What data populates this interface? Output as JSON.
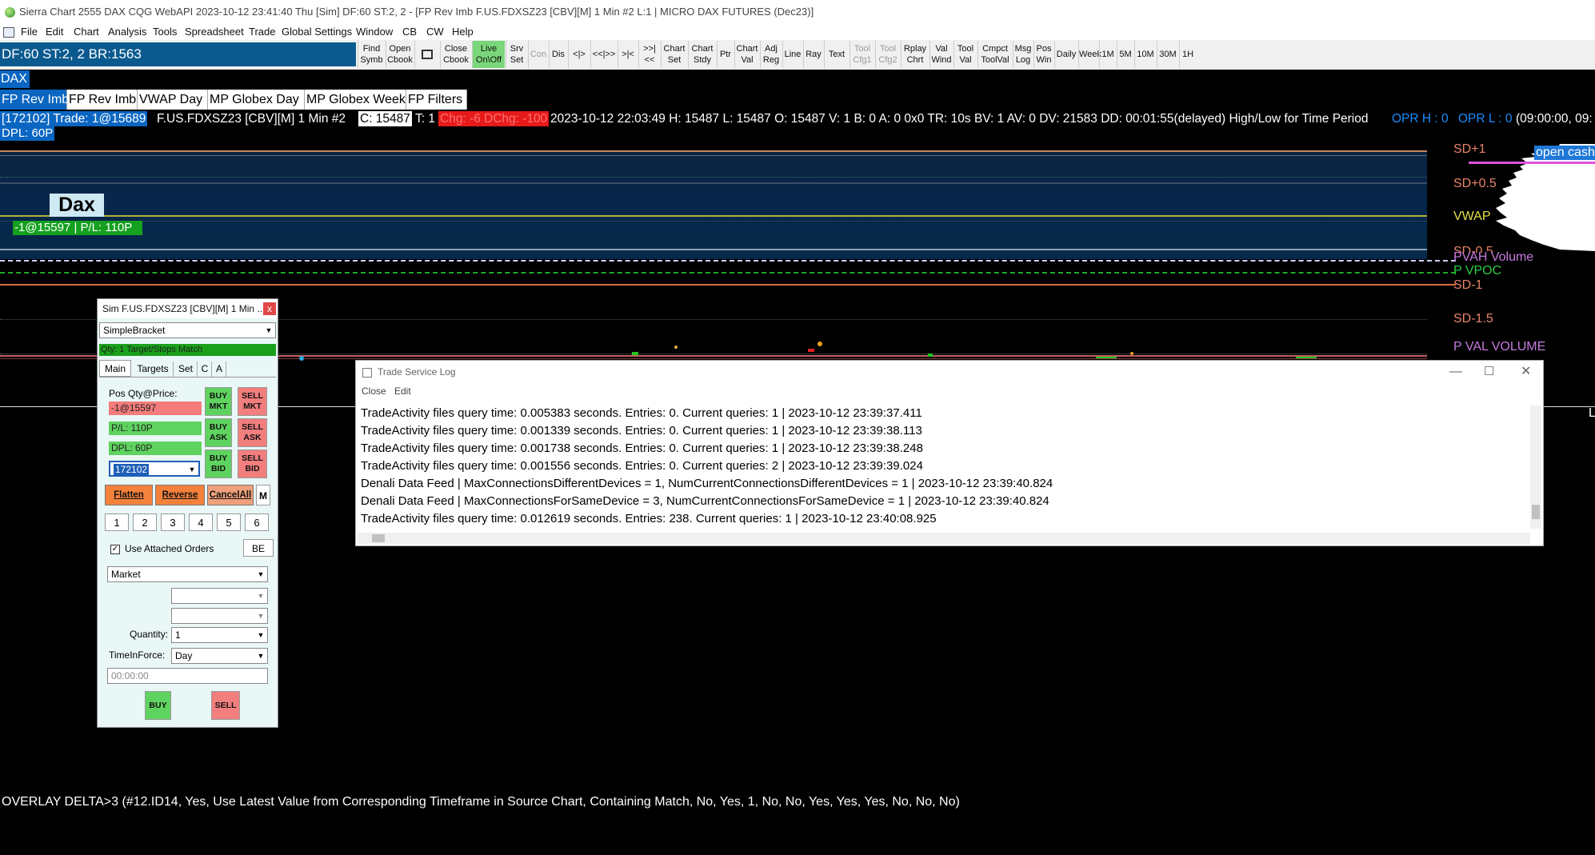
{
  "window": {
    "title": "Sierra Chart 2555 DAX CQG WebAPI 2023-10-12  23:41:40 Thu [Sim]  DF:60  ST:2, 2 - [FP Rev Imb F.US.FDXSZ23 [CBV][M]  1 Min  #2 L:1 | MICRO DAX FUTURES (Dec23)]"
  },
  "menu": [
    "File",
    "Edit",
    "Chart",
    "Analysis",
    "Tools",
    "Spreadsheet",
    "Trade",
    "Global Settings",
    "Window",
    "CB",
    "CW",
    "Help"
  ],
  "toolbar": {
    "status": "DF:60  ST:2, 2  BR:1563",
    "buttons": [
      {
        "l1": "Find",
        "l2": "Symb"
      },
      {
        "l1": "Open",
        "l2": "Cbook"
      },
      {
        "l1": "",
        "l2": ""
      },
      {
        "l1": "Close",
        "l2": "Cbook"
      },
      {
        "l1": "Live",
        "l2": "On\\Off"
      },
      {
        "l1": "Srv",
        "l2": "Set"
      },
      {
        "l1": "Con",
        "l2": ""
      },
      {
        "l1": "Dis",
        "l2": ""
      },
      {
        "l1": "<|>",
        "l2": ""
      },
      {
        "l1": "<<|>>",
        "l2": ""
      },
      {
        "l1": ">|<",
        "l2": ""
      },
      {
        "l1": ">>|<<",
        "l2": ""
      },
      {
        "l1": "Chart",
        "l2": "Set"
      },
      {
        "l1": "Chart",
        "l2": "Stdy"
      },
      {
        "l1": "Ptr",
        "l2": ""
      },
      {
        "l1": "Chart",
        "l2": "Val"
      },
      {
        "l1": "Adj",
        "l2": "Reg"
      },
      {
        "l1": "Line",
        "l2": ""
      },
      {
        "l1": "Ray",
        "l2": ""
      },
      {
        "l1": "Text",
        "l2": ""
      },
      {
        "l1": "Tool",
        "l2": "Cfg1"
      },
      {
        "l1": "Tool",
        "l2": "Cfg2"
      },
      {
        "l1": "Rplay",
        "l2": "Chrt"
      },
      {
        "l1": "Val",
        "l2": "Wind"
      },
      {
        "l1": "Tool",
        "l2": "Val"
      },
      {
        "l1": "Cmpct",
        "l2": "ToolVal"
      },
      {
        "l1": "Msg",
        "l2": "Log"
      },
      {
        "l1": "Pos",
        "l2": "Win"
      },
      {
        "l1": "Daily",
        "l2": ""
      },
      {
        "l1": "Week",
        "l2": ""
      },
      {
        "l1": "1M",
        "l2": ""
      },
      {
        "l1": "5M",
        "l2": ""
      },
      {
        "l1": "10M",
        "l2": ""
      },
      {
        "l1": "30M",
        "l2": ""
      },
      {
        "l1": "1H",
        "l2": ""
      }
    ]
  },
  "symbol_tab": "DAX",
  "chart_tabs": [
    "FP Rev Imb",
    "FP Rev Imb",
    "VWAP Day",
    "MP Globex Day",
    "MP Globex Week",
    "FP Filters"
  ],
  "info": {
    "account": "[172102]  Trade: 1@15689",
    "symbol": "F.US.FDXSZ23 [CBV][M]  1 Min  #2",
    "close": "C: 15487",
    "t": "T: 1",
    "chg": "Chg: -6",
    "dchg": "DChg: -100",
    "rest": "2023-10-12 22:03:49 H: 15487 L: 15487 O: 15487 V: 1 B: 0 A: 0 0x0 TR: 10s BV: 1 AV: 0 DV: 21583 DD: 00:01:55(delayed) High/Low for Time Period",
    "oprh": "OPR H : 0",
    "oprl": "OPR L : 0",
    "time": "(09:00:00, 09:",
    "dpl": "DPL: 60P"
  },
  "chart_labels": {
    "sd_p1": "SD+1",
    "open_cash": "open cash",
    "sd_p05": "SD+0.5",
    "vwap": "VWAP",
    "sd_m05": "SD-0.5",
    "pvah": "PVAH Volume",
    "pvpoc": "P VPOC",
    "sd_m1": "SD-1",
    "sd_m15": "SD-1.5",
    "pval": "P VAL VOLUME",
    "edge_l": "L"
  },
  "dax_label": "Dax",
  "position_label": "-1@15597 | P/L: 110P",
  "trade_window": {
    "title": "Sim F.US.FDXSZ23 [CBV][M]  1 Min  ...",
    "close": "x",
    "strategy": "SimpleBracket",
    "qty_target": "Qty: 1 Target/Stops Match",
    "tabs": [
      "Main",
      "Targets",
      "Set",
      "C",
      "A"
    ],
    "pos_label": "Pos Qty@Price:",
    "pos_value": "-1@15597",
    "pl": "P/L: 110P",
    "dpl": "DPL: 60P",
    "account": "172102",
    "buy_mkt": "BUY MKT",
    "sell_mkt": "SELL MKT",
    "buy_ask": "BUY ASK",
    "sell_ask": "SELL ASK",
    "buy_bid": "BUY BID",
    "sell_bid": "SELL BID",
    "flatten": "Flatten",
    "reverse": "Reverse",
    "cancel_all": "CancelAll",
    "m": "M",
    "numbers": [
      "1",
      "2",
      "3",
      "4",
      "5",
      "6"
    ],
    "attached": "Use Attached Orders",
    "be": "BE",
    "order_type": "Market",
    "quantity_label": "Quantity:",
    "quantity": "1",
    "tif_label": "TimeInForce:",
    "tif": "Day",
    "time": "00:00:00",
    "buy": "BUY",
    "sell": "SELL"
  },
  "log_window": {
    "title": "Trade Service Log",
    "menu": [
      "Close",
      "Edit"
    ],
    "lines": [
      "TradeActivity files query time: 0.005383 seconds. Entries: 0. Current queries: 1 | 2023-10-12  23:39:37.411",
      "TradeActivity files query time: 0.001339 seconds. Entries: 0. Current queries: 1 | 2023-10-12  23:39:38.113",
      "TradeActivity files query time: 0.001738 seconds. Entries: 0. Current queries: 1 | 2023-10-12  23:39:38.248",
      "TradeActivity files query time: 0.001556 seconds. Entries: 0. Current queries: 2 | 2023-10-12  23:39:39.024",
      "Denali Data Feed | MaxConnectionsDifferentDevices = 1, NumCurrentConnectionsDifferentDevices = 1 | 2023-10-12  23:39:40.824",
      "Denali Data Feed | MaxConnectionsForSameDevice = 3, NumCurrentConnectionsForSameDevice = 1 | 2023-10-12  23:39:40.824",
      "TradeActivity files query time: 0.012619 seconds. Entries: 238. Current queries: 1 | 2023-10-12  23:40:08.925"
    ]
  },
  "bottom_text": "OVERLAY DELTA>3   (#12.ID14, Yes, Use Latest Value from Corresponding Timeframe in Source Chart, Containing Match, No, Yes, 1, No, No, Yes, Yes, Yes, No, No, No)"
}
